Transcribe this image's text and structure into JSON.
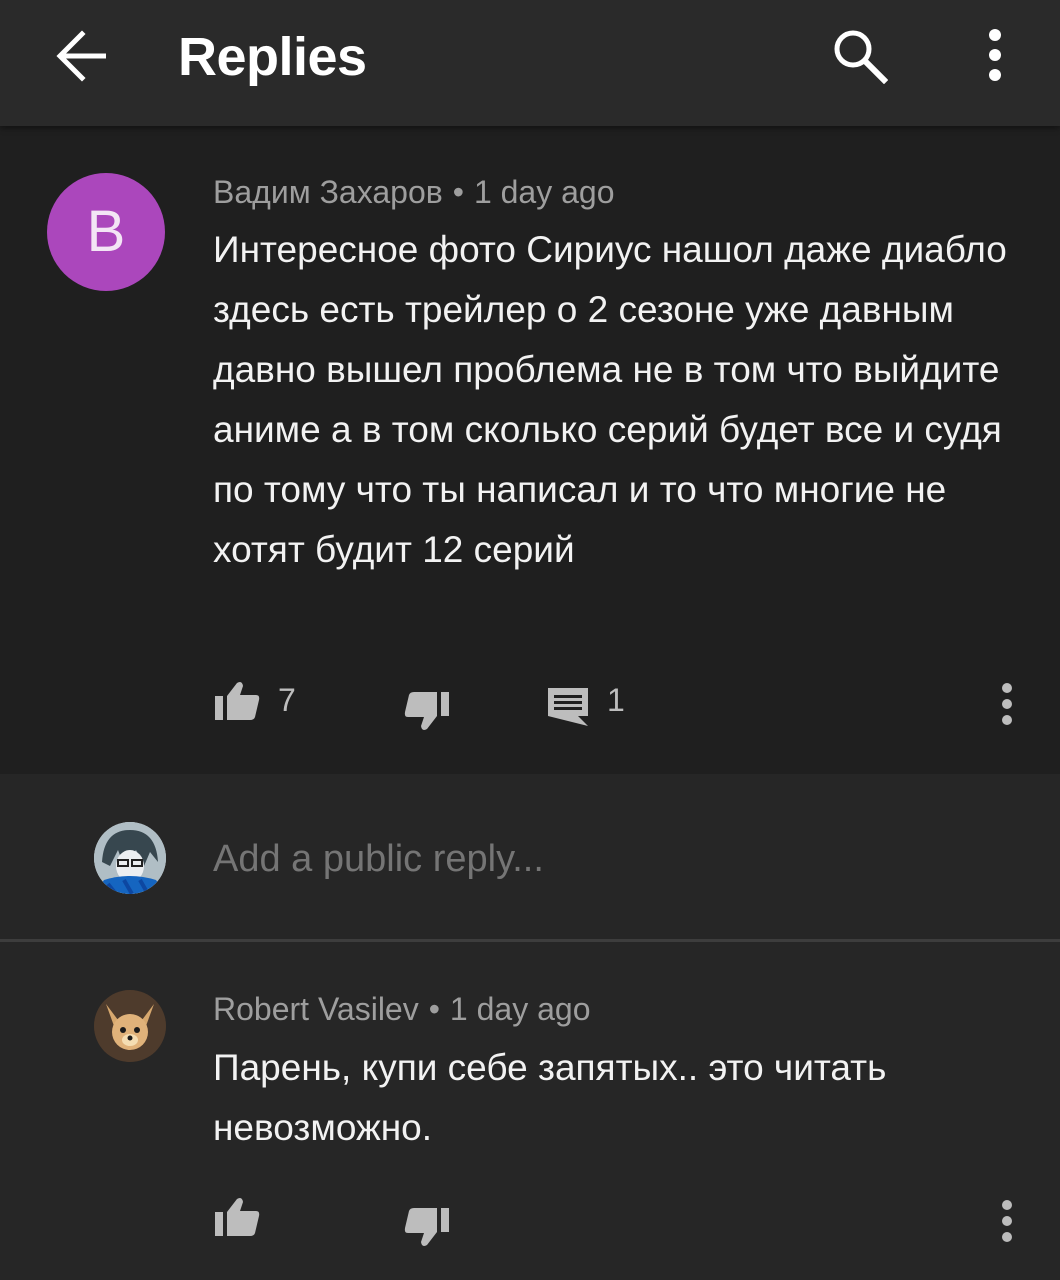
{
  "header": {
    "title": "Replies",
    "icons": [
      "back-arrow-icon",
      "search-icon",
      "more-vert-icon"
    ]
  },
  "main_comment": {
    "avatar_letter": "B",
    "avatar_color": "#ab47bc",
    "author": "Вадим Захаров",
    "separator": "•",
    "time": "1 day ago",
    "text": "Интересное фото Сириус нашол даже диабло здесь есть трейлер о 2 сезоне уже давным давно вышел проблема не в том что выйдите аниме а в том сколько серий будет все и судя по тому что ты написал и то что многие не хотят будит 12 серий",
    "likes": "7",
    "replies": "1"
  },
  "reply_box": {
    "placeholder": "Add a public reply..."
  },
  "reply": {
    "author": "Robert Vasilev",
    "separator": "•",
    "time": "1 day ago",
    "text": "Парень, купи себе запятых.. это читать невозможно."
  }
}
